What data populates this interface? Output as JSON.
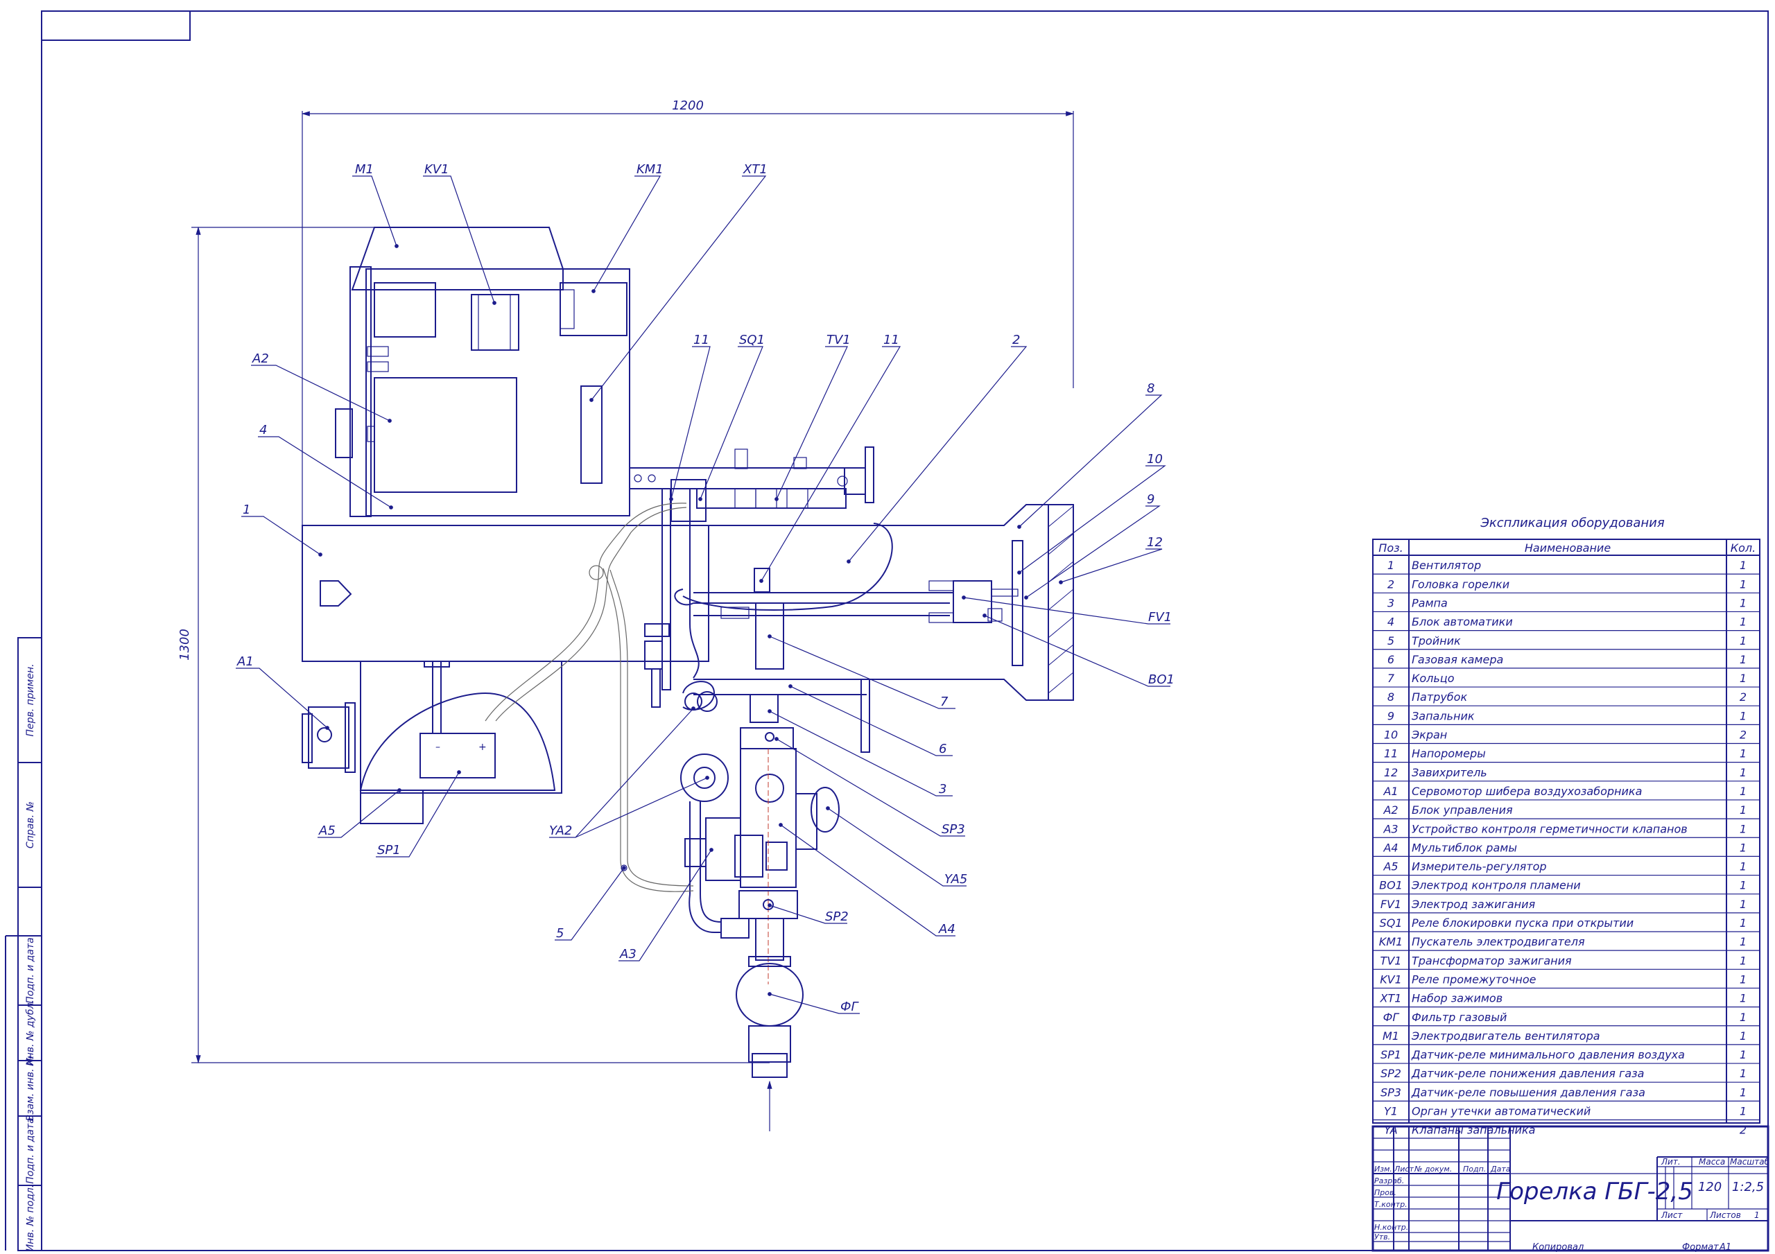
{
  "drawing": {
    "dim_width": "1200",
    "dim_height": "1300",
    "callouts": {
      "M1": "M1",
      "KV1": "KV1",
      "KM1": "KM1",
      "XT1": "XT1",
      "A2": "A2",
      "n4": "4",
      "n1": "1",
      "A1": "A1",
      "A5": "A5",
      "SP1": "SP1",
      "n11a": "11",
      "SQ1": "SQ1",
      "TV1": "TV1",
      "n11b": "11",
      "n2": "2",
      "n8": "8",
      "n10": "10",
      "n9": "9",
      "n12": "12",
      "FV1": "FV1",
      "BO1": "BO1",
      "n7": "7",
      "n6": "6",
      "n3": "3",
      "SP3": "SP3",
      "YA5": "YA5",
      "YA2": "YA2",
      "n5": "5",
      "A3": "A3",
      "A4": "A4",
      "SP2": "SP2",
      "FG": "ФГ"
    },
    "battery_minus": "–",
    "battery_plus": "+"
  },
  "table": {
    "title": "Экспликация оборудования",
    "col_pos": "Поз.",
    "col_name": "Наименование",
    "col_qty": "Кол.",
    "rows": [
      {
        "pos": "1",
        "name": "Вентилятор",
        "qty": "1"
      },
      {
        "pos": "2",
        "name": "Головка горелки",
        "qty": "1"
      },
      {
        "pos": "3",
        "name": "Рампа",
        "qty": "1"
      },
      {
        "pos": "4",
        "name": "Блок автоматики",
        "qty": "1"
      },
      {
        "pos": "5",
        "name": "Тройник",
        "qty": "1"
      },
      {
        "pos": "6",
        "name": "Газовая камера",
        "qty": "1"
      },
      {
        "pos": "7",
        "name": "Кольцо",
        "qty": "1"
      },
      {
        "pos": "8",
        "name": "Патрубок",
        "qty": "2"
      },
      {
        "pos": "9",
        "name": "Запальник",
        "qty": "1"
      },
      {
        "pos": "10",
        "name": "Экран",
        "qty": "2"
      },
      {
        "pos": "11",
        "name": "Напоромеры",
        "qty": "1"
      },
      {
        "pos": "12",
        "name": "Завихритель",
        "qty": "1"
      },
      {
        "pos": "A1",
        "name": "Сервомотор шибера воздухозаборника",
        "qty": "1"
      },
      {
        "pos": "A2",
        "name": "Блок управления",
        "qty": "1"
      },
      {
        "pos": "A3",
        "name": "Устройство контроля герметичности клапанов",
        "qty": "1"
      },
      {
        "pos": "A4",
        "name": "Мультиблок рамы",
        "qty": "1"
      },
      {
        "pos": "A5",
        "name": "Измеритель-регулятор",
        "qty": "1"
      },
      {
        "pos": "BO1",
        "name": "Электрод контроля пламени",
        "qty": "1"
      },
      {
        "pos": "FV1",
        "name": "Электрод зажигания",
        "qty": "1"
      },
      {
        "pos": "SQ1",
        "name": "Реле блокировки пуска при открытии",
        "qty": "1"
      },
      {
        "pos": "KM1",
        "name": "Пускатель электродвигателя",
        "qty": "1"
      },
      {
        "pos": "TV1",
        "name": "Трансформатор зажигания",
        "qty": "1"
      },
      {
        "pos": "KV1",
        "name": "Реле промежуточное",
        "qty": "1"
      },
      {
        "pos": "XT1",
        "name": "Набор зажимов",
        "qty": "1"
      },
      {
        "pos": "ФГ",
        "name": "Фильтр газовый",
        "qty": "1"
      },
      {
        "pos": "M1",
        "name": "Электродвигатель вентилятора",
        "qty": "1"
      },
      {
        "pos": "SP1",
        "name": "Датчик-реле минимального давления воздуха",
        "qty": "1"
      },
      {
        "pos": "SP2",
        "name": "Датчик-реле понижения давления газа",
        "qty": "1"
      },
      {
        "pos": "SP3",
        "name": "Датчик-реле повышения давления газа",
        "qty": "1"
      },
      {
        "pos": "Y1",
        "name": "Орган утечки автоматический",
        "qty": "1"
      },
      {
        "pos": "YA",
        "name": "Клапаны запальника",
        "qty": "2"
      }
    ]
  },
  "title_block": {
    "title": "Горелка ГБГ-2,5",
    "h_izm": "Изм.",
    "h_list": "Лист",
    "h_doc": "№ докум.",
    "h_sign": "Подп.",
    "h_date": "Дата",
    "r_razrab": "Разраб.",
    "r_prov": "Пров.",
    "r_tkontr": "Т.контр.",
    "r_nkontr": "Н.контр.",
    "r_utv": "Утв.",
    "lit": "Лит.",
    "massa": "Масса",
    "masshtab": "Масштаб",
    "mass_val": "120",
    "scale_val": "1:2,5",
    "sheet": "Лист",
    "sheets": "Листов",
    "sheets_val": "1",
    "copied": "Копировал",
    "format": "Формат",
    "format_val": "А1"
  },
  "side_stamp": {
    "f1": "Перв. примен.",
    "f2": "Справ. №",
    "f3": "Подп. и дата",
    "f4": "Инв. № дубл.",
    "f5": "Взам. инв. №",
    "f6": "Подп. и дата",
    "f7": "Инв. № подл."
  }
}
